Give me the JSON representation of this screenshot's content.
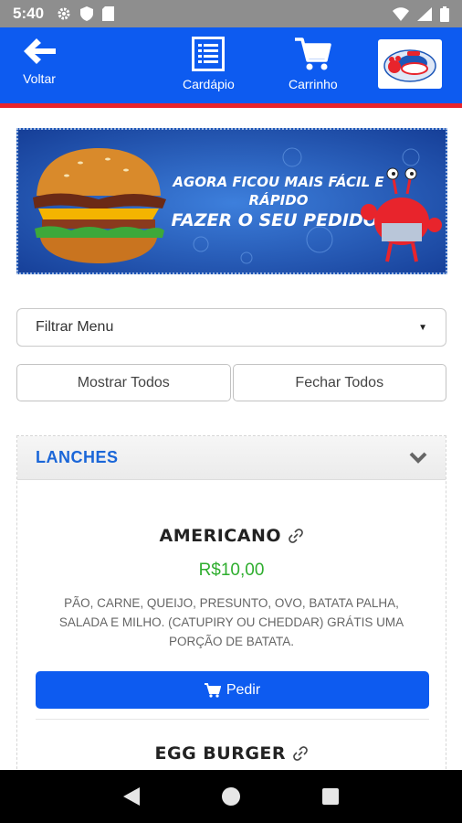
{
  "status_bar": {
    "time": "5:40",
    "left_icons": [
      "gear-icon",
      "shield-icon",
      "sd-card-icon"
    ],
    "right_icons": [
      "wifi-icon",
      "signal-icon",
      "battery-icon"
    ]
  },
  "app_bar": {
    "back_label": "Voltar",
    "menu_label": "Cardápio",
    "cart_label": "Carrinho",
    "colors": {
      "background": "#0d5bf0",
      "accent": "#e8242c"
    }
  },
  "banner": {
    "line1": "AGORA FICOU MAIS FÁCIL E RÁPIDO",
    "line2": "FAZER O SEU PEDIDO!"
  },
  "filter": {
    "selected": "Filtrar Menu"
  },
  "buttons": {
    "show_all": "Mostrar Todos",
    "close_all": "Fechar Todos"
  },
  "section": {
    "title": "LANCHES",
    "items": [
      {
        "name": "AMERICANO",
        "price": "R$10,00",
        "description": "PÃO, CARNE, QUEIJO, PRESUNTO, OVO, BATATA PALHA, SALADA E MILHO. (CATUPIRY OU CHEDDAR) GRÁTIS UMA PORÇÃO DE BATATA.",
        "order_label": "Pedir"
      },
      {
        "name": "EGG BURGER"
      }
    ]
  },
  "colors": {
    "price_green": "#2fae2f",
    "title_blue": "#1a66d8"
  }
}
